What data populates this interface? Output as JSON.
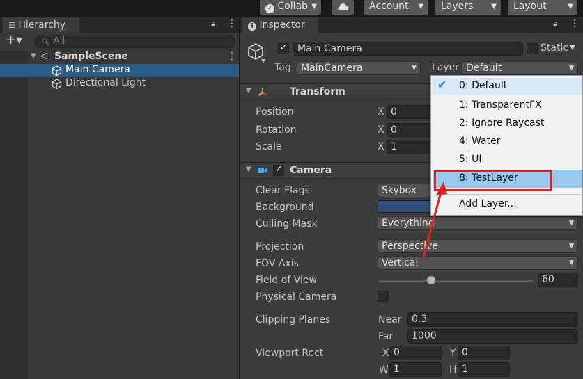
{
  "toolbar": {
    "collab": "Collab",
    "account": "Account",
    "layers": "Layers",
    "layout": "Layout"
  },
  "hierarchy": {
    "tab": "Hierarchy",
    "search_placeholder": "All",
    "scene": "SampleScene",
    "items": [
      "Main Camera",
      "Directional Light"
    ]
  },
  "inspector": {
    "tab": "Inspector",
    "object_name": "Main Camera",
    "static_label": "Static",
    "tag_label": "Tag",
    "tag_value": "MainCamera",
    "layer_label": "Layer",
    "layer_value": "Default",
    "transform": {
      "title": "Transform",
      "position_label": "Position",
      "position_x": "0",
      "rotation_label": "Rotation",
      "rotation_x": "0",
      "scale_label": "Scale",
      "scale_x": "1",
      "x_label": "X"
    },
    "camera": {
      "title": "Camera",
      "clear_flags_label": "Clear Flags",
      "clear_flags_value": "Skybox",
      "background_label": "Background",
      "background_color": "#314D79",
      "culling_mask_label": "Culling Mask",
      "culling_mask_value": "Everything",
      "projection_label": "Projection",
      "projection_value": "Perspective",
      "fov_axis_label": "FOV Axis",
      "fov_axis_value": "Vertical",
      "fov_label": "Field of View",
      "fov_value": "60",
      "fov_slider_fraction": 0.34,
      "physical_label": "Physical Camera",
      "clipping_label": "Clipping Planes",
      "near_label": "Near",
      "near_value": "0.3",
      "far_label": "Far",
      "far_value": "1000",
      "viewport_label": "Viewport Rect",
      "vp_x_label": "X",
      "vp_x": "0",
      "vp_y_label": "Y",
      "vp_y": "0",
      "vp_w_label": "W",
      "vp_w": "1",
      "vp_h_label": "H",
      "vp_h": "1"
    }
  },
  "layer_menu": {
    "items": [
      "0: Default",
      "1: TransparentFX",
      "2: Ignore Raycast",
      "4: Water",
      "5: UI",
      "8: TestLayer"
    ],
    "add": "Add Layer...",
    "highlight_color": "#E02020",
    "selected_bg": "#99C9EF"
  }
}
